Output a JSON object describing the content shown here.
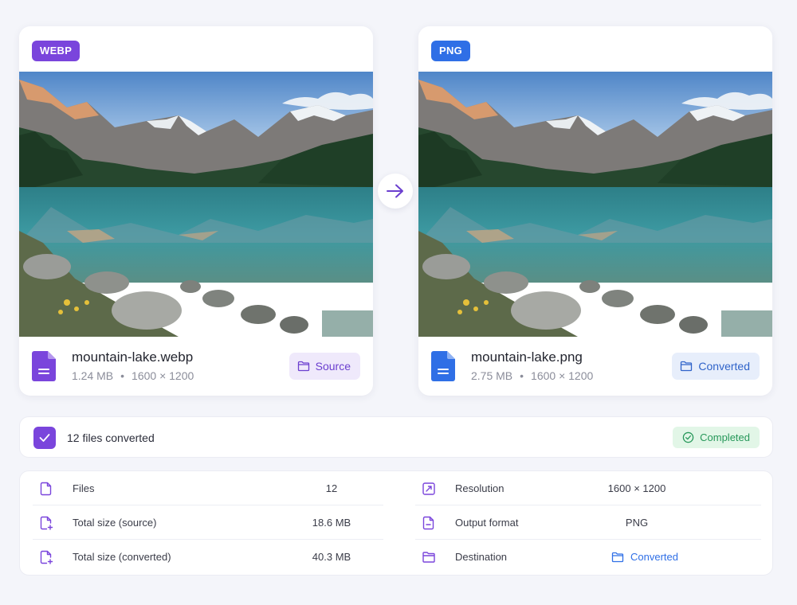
{
  "source_card": {
    "format_badge": "WEBP",
    "file_name": "mountain-lake.webp",
    "file_size": "1.24 MB",
    "separator": "•",
    "dimensions": "1600 × 1200",
    "action_label": "Source",
    "accent_color": "#7a45dc"
  },
  "converted_card": {
    "format_badge": "PNG",
    "file_name": "mountain-lake.png",
    "file_size": "2.75 MB",
    "separator": "•",
    "dimensions": "1600 × 1200",
    "action_label": "Converted",
    "accent_color": "#2f6fe6"
  },
  "status": {
    "summary": "12 files converted",
    "state_label": "Completed",
    "state_color": "#27985a"
  },
  "details": {
    "left": [
      {
        "icon": "file-icon",
        "label": "Files",
        "value": "12"
      },
      {
        "icon": "file-plus-icon",
        "label": "Total size (source)",
        "value": "18.6 MB"
      },
      {
        "icon": "file-plus-icon",
        "label": "Total size (converted)",
        "value": "40.3 MB"
      }
    ],
    "right": [
      {
        "icon": "resize-icon",
        "label": "Resolution",
        "value": "1600 × 1200"
      },
      {
        "icon": "file-minus-icon",
        "label": "Output format",
        "value": "PNG"
      },
      {
        "icon": "folder-icon",
        "label": "Destination",
        "value": "Converted"
      }
    ]
  }
}
